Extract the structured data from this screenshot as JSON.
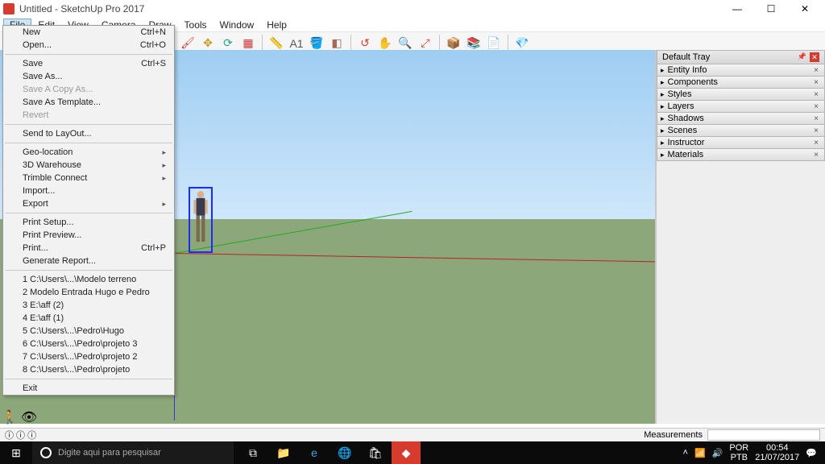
{
  "title": "Untitled - SketchUp Pro 2017",
  "menubar": {
    "items": [
      "File",
      "Edit",
      "View",
      "Camera",
      "Draw",
      "Tools",
      "Window",
      "Help"
    ]
  },
  "file_menu": {
    "new": "New",
    "new_key": "Ctrl+N",
    "open": "Open...",
    "open_key": "Ctrl+O",
    "save": "Save",
    "save_key": "Ctrl+S",
    "save_as": "Save As...",
    "save_copy": "Save A Copy As...",
    "save_template": "Save As Template...",
    "revert": "Revert",
    "send_layout": "Send to LayOut...",
    "geo": "Geo-location",
    "warehouse": "3D Warehouse",
    "trimble": "Trimble Connect",
    "import": "Import...",
    "export": "Export",
    "print_setup": "Print Setup...",
    "print_preview": "Print Preview...",
    "print": "Print...",
    "print_key": "Ctrl+P",
    "report": "Generate Report...",
    "recent": [
      "1 C:\\Users\\...\\Modelo terreno",
      "2 Modelo Entrada Hugo e Pedro",
      "3 E:\\aff (2)",
      "4 E:\\aff (1)",
      "5 C:\\Users\\...\\Pedro\\Hugo",
      "6 C:\\Users\\...\\Pedro\\projeto 3",
      "7 C:\\Users\\...\\Pedro\\projeto 2",
      "8 C:\\Users\\...\\Pedro\\projeto"
    ],
    "exit": "Exit",
    "submenu_arrow": "▸"
  },
  "tray": {
    "title": "Default Tray",
    "panels": [
      "Entity Info",
      "Components",
      "Styles",
      "Layers",
      "Shadows",
      "Scenes",
      "Instructor",
      "Materials"
    ]
  },
  "statusbar": {
    "help_icons": "ⓘ ⓘ ⓘ",
    "measurements_label": "Measurements"
  },
  "taskbar": {
    "search_placeholder": "Digite aqui para pesquisar",
    "lang1": "POR",
    "lang2": "PTB",
    "time": "00:54",
    "date": "21/07/2017"
  },
  "icons": {
    "up": "˄",
    "wifi": "📶",
    "sound": "🔊",
    "notif": "💬"
  }
}
